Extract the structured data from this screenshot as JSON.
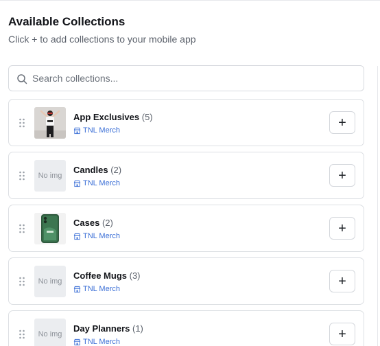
{
  "header": {
    "title": "Available Collections",
    "subtitle": "Click + to add collections to your mobile app"
  },
  "search": {
    "placeholder": "Search collections...",
    "value": ""
  },
  "icons": {
    "search": "search-icon",
    "drag": "drag-handle-icon",
    "store": "store-icon",
    "add": "plus-icon"
  },
  "colors": {
    "accent_link": "#3b6fd6",
    "border": "#dcdfe3"
  },
  "collections": [
    {
      "name": "App Exclusives",
      "count": "(5)",
      "shop": "TNL Merch",
      "image": "photo-person",
      "no_img_label": "",
      "add_label": "+"
    },
    {
      "name": "Candles",
      "count": "(2)",
      "shop": "TNL Merch",
      "image": "none",
      "no_img_label": "No img",
      "add_label": "+"
    },
    {
      "name": "Cases",
      "count": "(2)",
      "shop": "TNL Merch",
      "image": "photo-phone-case",
      "no_img_label": "",
      "add_label": "+"
    },
    {
      "name": "Coffee Mugs",
      "count": "(3)",
      "shop": "TNL Merch",
      "image": "none",
      "no_img_label": "No img",
      "add_label": "+"
    },
    {
      "name": "Day Planners",
      "count": "(1)",
      "shop": "TNL Merch",
      "image": "none",
      "no_img_label": "No img",
      "add_label": "+"
    }
  ]
}
